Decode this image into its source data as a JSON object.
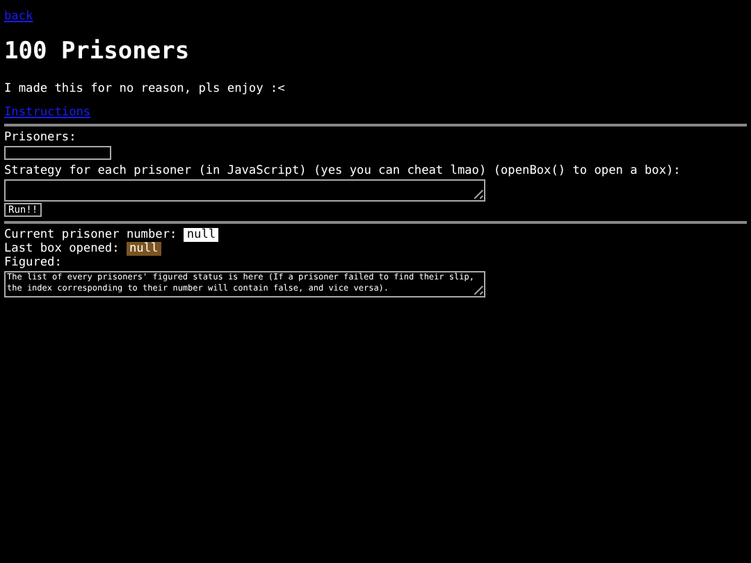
{
  "back_link": "back",
  "title": "100 Prisoners",
  "intro": "I made this for no reason, pls enjoy :<",
  "instructions_link": "Instructions",
  "prisoners": {
    "label": "Prisoners:"
  },
  "strategy": {
    "label": "Strategy for each prisoner (in JavaScript) (yes you can cheat lmao) (openBox() to open a box):"
  },
  "run_button": "Run!!",
  "current": {
    "label": "Current prisoner number:",
    "value": "null"
  },
  "last_box": {
    "label": "Last box opened:",
    "value": "null"
  },
  "figured": {
    "label": "Figured:",
    "placeholder": "The list of every prisoners' figured status is here (If a prisoner failed to find their slip, the index corresponding to their number will contain false, and vice versa)."
  }
}
